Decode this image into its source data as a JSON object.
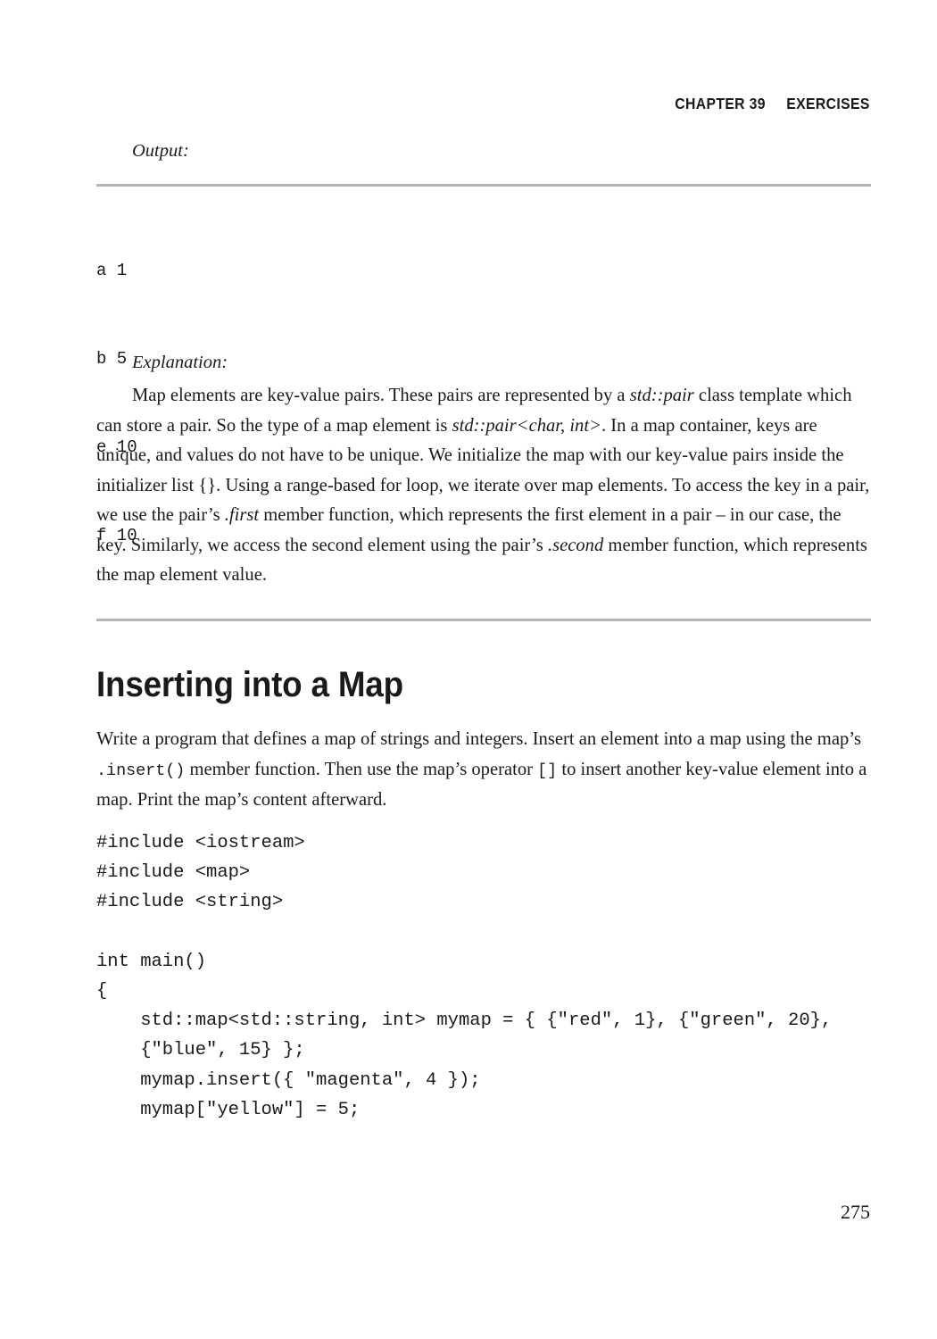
{
  "header": {
    "chapter": "CHAPTER 39",
    "section": "EXERCISES"
  },
  "output": {
    "label": "Output:",
    "lines": [
      "a 1",
      "b 5",
      "e 10",
      "f 10"
    ]
  },
  "explanation": {
    "label": "Explanation:",
    "text_part1": "Map elements are key-value pairs. These pairs are represented by a ",
    "italic1": "std::pair",
    "text_part2": " class template which can store a pair. So the type of a map element is ",
    "italic2": "std::pair<char, int>",
    "text_part3": ". In a map container, keys are unique, and values do not have to be unique. We initialize the map with our key-value pairs inside the initializer list {}. Using a range-based for loop, we iterate over map elements. To access the key in a pair, we use the pair’s ",
    "italic3": ".first",
    "text_part4": " member function, which represents the first element in a pair – in our case, the key. Similarly, we access the second element using the pair’s ",
    "italic4": ".second",
    "text_part5": " member function, which represents the map element value."
  },
  "section": {
    "heading": "Inserting into a Map"
  },
  "task": {
    "text_part1": "Write a program that defines a map of strings and integers. Insert an element into a map using the map’s ",
    "code1": ".insert()",
    "text_part2": " member function. Then use the map’s operator ",
    "code2": "[]",
    "text_part3": " to insert another key-value element into a map. Print the map’s content afterward."
  },
  "program": {
    "code": "#include <iostream>\n#include <map>\n#include <string>\n\nint main()\n{\n    std::map<std::string, int> mymap = { {\"red\", 1}, {\"green\", 20},\n    {\"blue\", 15} };\n    mymap.insert({ \"magenta\", 4 });\n    mymap[\"yellow\"] = 5;"
  },
  "folio": {
    "page_number": "275"
  },
  "colors": {
    "text": "#1a1a1a",
    "rule": "#b4b4b4",
    "background": "#ffffff"
  }
}
